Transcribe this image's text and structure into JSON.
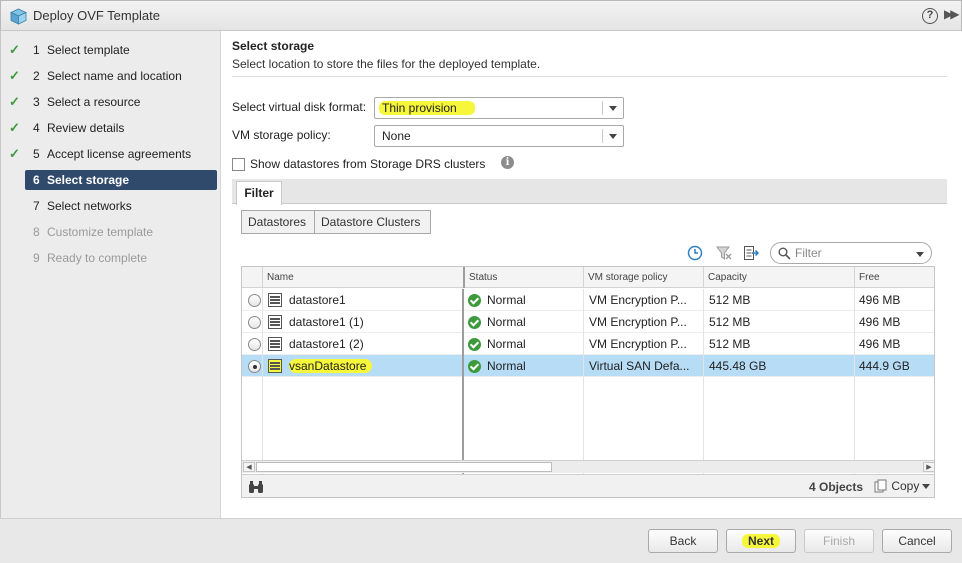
{
  "window": {
    "title": "Deploy OVF Template",
    "help_label": "?"
  },
  "steps": [
    {
      "num": "1",
      "label": "Select template",
      "state": "done"
    },
    {
      "num": "2",
      "label": "Select name and location",
      "state": "done"
    },
    {
      "num": "3",
      "label": "Select a resource",
      "state": "done"
    },
    {
      "num": "4",
      "label": "Review details",
      "state": "done"
    },
    {
      "num": "5",
      "label": "Accept license agreements",
      "state": "done"
    },
    {
      "num": "6",
      "label": "Select storage",
      "state": "active"
    },
    {
      "num": "7",
      "label": "Select networks",
      "state": "todo"
    },
    {
      "num": "8",
      "label": "Customize template",
      "state": "disabled"
    },
    {
      "num": "9",
      "label": "Ready to complete",
      "state": "disabled"
    }
  ],
  "page": {
    "title": "Select storage",
    "subtitle": "Select location to store the files for the deployed template."
  },
  "form": {
    "disk_format_label": "Select virtual disk format:",
    "disk_format_value": "Thin provision",
    "storage_policy_label": "VM storage policy:",
    "storage_policy_value": "None",
    "show_drs_label": "Show datastores from Storage DRS clusters",
    "info_glyph": "i"
  },
  "filter": {
    "tab_label": "Filter",
    "segments": [
      "Datastores",
      "Datastore Clusters"
    ],
    "placeholder": "Filter"
  },
  "grid": {
    "columns": [
      "Name",
      "Status",
      "VM storage policy",
      "Capacity",
      "Free"
    ],
    "rows": [
      {
        "name": "datastore1",
        "status": "Normal",
        "policy": "VM Encryption P...",
        "capacity": "512  MB",
        "free": "496  MB",
        "selected": false
      },
      {
        "name": "datastore1 (1)",
        "status": "Normal",
        "policy": "VM Encryption P...",
        "capacity": "512  MB",
        "free": "496  MB",
        "selected": false
      },
      {
        "name": "datastore1 (2)",
        "status": "Normal",
        "policy": "VM Encryption P...",
        "capacity": "512  MB",
        "free": "496  MB",
        "selected": false
      },
      {
        "name": "vsanDatastore",
        "status": "Normal",
        "policy": "Virtual SAN Defa...",
        "capacity": "445.48  GB",
        "free": "444.9  GB",
        "selected": true
      }
    ],
    "object_count": "4 Objects",
    "copy_label": "Copy"
  },
  "buttons": {
    "back": "Back",
    "next": "Next",
    "finish": "Finish",
    "cancel": "Cancel"
  },
  "colors": {
    "highlight": "#f6f63a",
    "active_step": "#2f4a6b",
    "selected_row": "#b7dcf6",
    "status_ok": "#3c9a3c"
  }
}
